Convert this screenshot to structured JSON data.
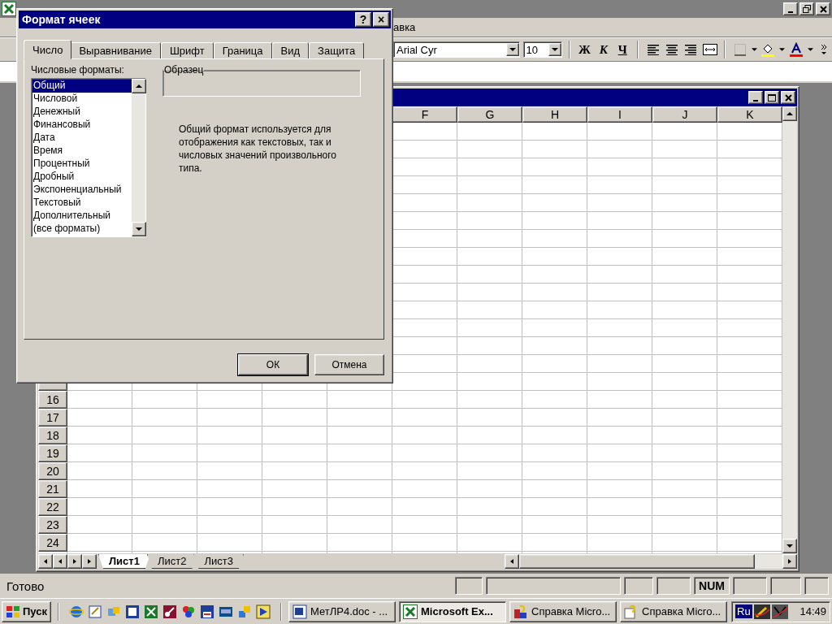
{
  "menu_bar": {
    "items": [
      "авка"
    ]
  },
  "toolbar": {
    "font": "Arial Cyr",
    "size": "10",
    "bold_key": "Ж",
    "italic_key": "К",
    "underline_key": "Ч"
  },
  "workbook": {
    "columns": [
      "F",
      "G",
      "H",
      "I",
      "J",
      "K"
    ],
    "rows": [
      "16",
      "17",
      "18",
      "19",
      "20",
      "21",
      "22",
      "23",
      "24"
    ],
    "sheet_tabs": [
      {
        "label": "Лист1",
        "selected": true
      },
      {
        "label": "Лист2",
        "selected": false
      },
      {
        "label": "Лист3",
        "selected": false
      }
    ]
  },
  "status_bar": {
    "text": "Готово",
    "indicators": [
      "NUM"
    ]
  },
  "taskbar": {
    "start": "Пуск",
    "tasks": [
      {
        "label": "МетЛР4.doc - ...",
        "kind": "word",
        "selected": false
      },
      {
        "label": "Microsoft Ex...",
        "kind": "excel",
        "selected": true
      },
      {
        "label": "Справка Micro...",
        "kind": "help",
        "selected": false
      },
      {
        "label": "Справка Micro...",
        "kind": "helpdoc",
        "selected": false
      }
    ],
    "language": "Ru",
    "clock": "14:49"
  },
  "dialog": {
    "title": "Формат ячеек",
    "help_key": "?",
    "close_key": "×",
    "tabs": [
      {
        "label": "Число",
        "selected": true
      },
      {
        "label": "Выравнивание",
        "selected": false
      },
      {
        "label": "Шрифт",
        "selected": false
      },
      {
        "label": "Граница",
        "selected": false
      },
      {
        "label": "Вид",
        "selected": false
      },
      {
        "label": "Защита",
        "selected": false
      }
    ],
    "list_label": "Числовые форматы:",
    "formats": [
      {
        "label": "Общий",
        "selected": true
      },
      {
        "label": "Числовой",
        "selected": false
      },
      {
        "label": "Денежный",
        "selected": false
      },
      {
        "label": "Финансовый",
        "selected": false
      },
      {
        "label": "Дата",
        "selected": false
      },
      {
        "label": "Время",
        "selected": false
      },
      {
        "label": "Процентный",
        "selected": false
      },
      {
        "label": "Дробный",
        "selected": false
      },
      {
        "label": "Экспоненциальный",
        "selected": false
      },
      {
        "label": "Текстовый",
        "selected": false
      },
      {
        "label": "Дополнительный",
        "selected": false
      },
      {
        "label": "(все форматы)",
        "selected": false
      }
    ],
    "sample_label": "Образец",
    "description": "Общий формат используется для отображения как текстовых, так и числовых значений произвольного типа.",
    "buttons": [
      "ОК",
      "Отмена"
    ]
  }
}
